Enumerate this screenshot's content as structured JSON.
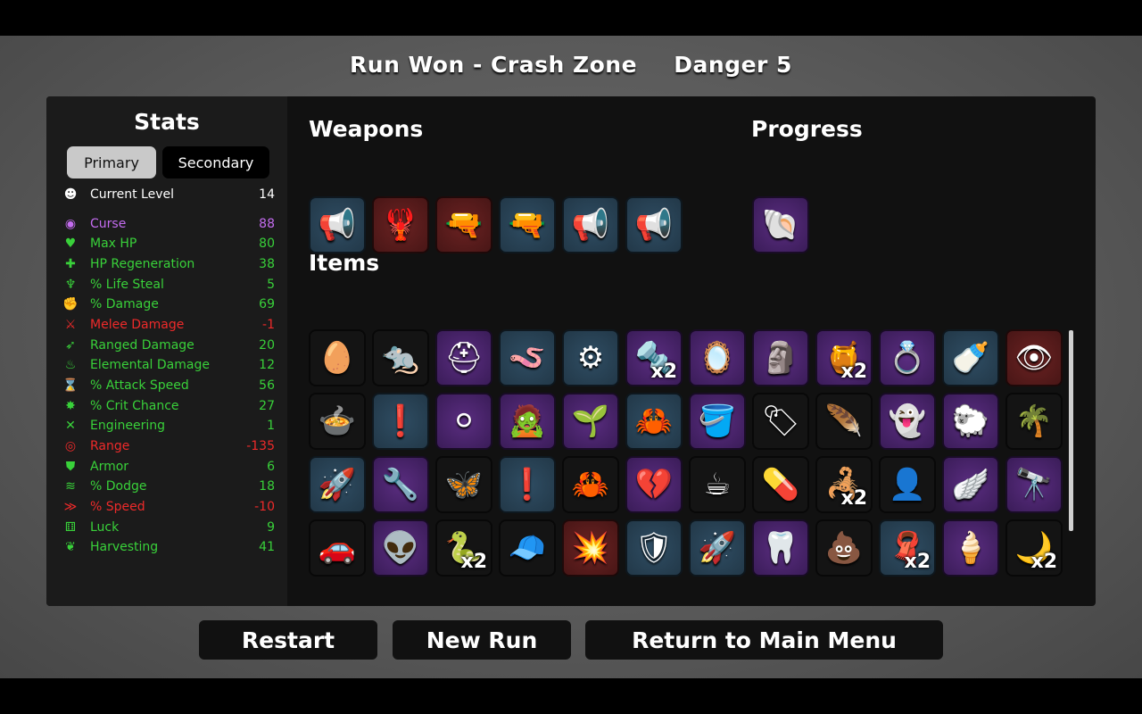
{
  "header": {
    "run_title": "Run Won - Crash Zone",
    "danger": "Danger 5"
  },
  "stats": {
    "title": "Stats",
    "tabs": [
      "Primary",
      "Secondary"
    ],
    "rows": [
      {
        "icon": "☻",
        "label": "Current Level",
        "value": "14",
        "color": "#ffffff"
      },
      {
        "icon": "◉",
        "label": "Curse",
        "value": "88",
        "color": "#c46cf0"
      },
      {
        "icon": "♥",
        "label": "Max HP",
        "value": "80",
        "color": "#39d13a"
      },
      {
        "icon": "✚",
        "label": "HP Regeneration",
        "value": "38",
        "color": "#39d13a"
      },
      {
        "icon": "♆",
        "label": "% Life Steal",
        "value": "5",
        "color": "#39d13a"
      },
      {
        "icon": "✊",
        "label": "% Damage",
        "value": "69",
        "color": "#39d13a"
      },
      {
        "icon": "⚔",
        "label": "Melee Damage",
        "value": "-1",
        "color": "#ee2a2a"
      },
      {
        "icon": "➶",
        "label": "Ranged Damage",
        "value": "20",
        "color": "#39d13a"
      },
      {
        "icon": "♨",
        "label": "Elemental Damage",
        "value": "12",
        "color": "#39d13a"
      },
      {
        "icon": "⌛",
        "label": "% Attack Speed",
        "value": "56",
        "color": "#39d13a"
      },
      {
        "icon": "✸",
        "label": "% Crit Chance",
        "value": "27",
        "color": "#39d13a"
      },
      {
        "icon": "✕",
        "label": "Engineering",
        "value": "1",
        "color": "#39d13a"
      },
      {
        "icon": "◎",
        "label": "Range",
        "value": "-135",
        "color": "#ee2a2a"
      },
      {
        "icon": "⛊",
        "label": "Armor",
        "value": "6",
        "color": "#39d13a"
      },
      {
        "icon": "≋",
        "label": "% Dodge",
        "value": "18",
        "color": "#39d13a"
      },
      {
        "icon": "≫",
        "label": "% Speed",
        "value": "-10",
        "color": "#ee2a2a"
      },
      {
        "icon": "⚅",
        "label": "Luck",
        "value": "9",
        "color": "#39d13a"
      },
      {
        "icon": "❦",
        "label": "Harvesting",
        "value": "41",
        "color": "#39d13a"
      }
    ]
  },
  "weapons": {
    "title": "Weapons",
    "items": [
      {
        "icon": "megaphone-icon",
        "glyph": "📢",
        "bg": "blue"
      },
      {
        "icon": "lobster-icon",
        "glyph": "🦞",
        "bg": "red"
      },
      {
        "icon": "revolver-icon",
        "glyph": "🔫",
        "bg": "red"
      },
      {
        "icon": "revolver-icon",
        "glyph": "🔫",
        "bg": "blue"
      },
      {
        "icon": "megaphone-icon",
        "glyph": "📢",
        "bg": "blue"
      },
      {
        "icon": "megaphone-icon",
        "glyph": "📢",
        "bg": "blue"
      }
    ]
  },
  "progress": {
    "title": "Progress",
    "items": [
      {
        "icon": "hermit-crab-icon",
        "glyph": "🐚",
        "bg": "purple"
      }
    ]
  },
  "items": {
    "title": "Items",
    "list": [
      {
        "icon": "egg-skull-icon",
        "glyph": "🥚",
        "bg": "dark",
        "count": ""
      },
      {
        "icon": "ferret-icon",
        "glyph": "🐀",
        "bg": "dark",
        "count": ""
      },
      {
        "icon": "knight-helmet-icon",
        "glyph": "⛑",
        "bg": "purple",
        "count": ""
      },
      {
        "icon": "worm-icon",
        "glyph": "🪱",
        "bg": "blue",
        "count": ""
      },
      {
        "icon": "gear-ring-icon",
        "glyph": "⚙",
        "bg": "blue",
        "count": ""
      },
      {
        "icon": "bullet-icon",
        "glyph": "🔩",
        "bg": "purple",
        "count": "x2"
      },
      {
        "icon": "mirror-icon",
        "glyph": "🪞",
        "bg": "purple",
        "count": ""
      },
      {
        "icon": "statue-icon",
        "glyph": "🗿",
        "bg": "purple",
        "count": ""
      },
      {
        "icon": "honey-jar-icon",
        "glyph": "🍯",
        "bg": "purple",
        "count": "x2"
      },
      {
        "icon": "ring-icon",
        "glyph": "💍",
        "bg": "purple",
        "count": ""
      },
      {
        "icon": "bottle-icon",
        "glyph": "🍼",
        "bg": "blue",
        "count": ""
      },
      {
        "icon": "eye-swirl-icon",
        "glyph": "👁",
        "bg": "red",
        "count": ""
      },
      {
        "icon": "pot-icon",
        "glyph": "🍲",
        "bg": "dark",
        "count": ""
      },
      {
        "icon": "alert-slime-icon",
        "glyph": "❗",
        "bg": "blue",
        "count": ""
      },
      {
        "icon": "snowball-icon",
        "glyph": "⚪",
        "bg": "purple",
        "count": ""
      },
      {
        "icon": "zombie-head-icon",
        "glyph": "🧟",
        "bg": "purple",
        "count": ""
      },
      {
        "icon": "sprout-icon",
        "glyph": "🌱",
        "bg": "purple",
        "count": ""
      },
      {
        "icon": "claw-ring-icon",
        "glyph": "🦀",
        "bg": "blue",
        "count": ""
      },
      {
        "icon": "barrel-icon",
        "glyph": "🪣",
        "bg": "purple",
        "count": ""
      },
      {
        "icon": "tag-icon",
        "glyph": "🏷",
        "bg": "dark",
        "count": ""
      },
      {
        "icon": "feather-icon",
        "glyph": "🪶",
        "bg": "dark",
        "count": ""
      },
      {
        "icon": "ghost-blob-icon",
        "glyph": "👻",
        "bg": "purple",
        "count": ""
      },
      {
        "icon": "tardigrade-icon",
        "glyph": "🐑",
        "bg": "purple",
        "count": ""
      },
      {
        "icon": "palm-tree-icon",
        "glyph": "🌴",
        "bg": "dark",
        "count": ""
      },
      {
        "icon": "rocket-icon",
        "glyph": "🚀",
        "bg": "blue",
        "count": ""
      },
      {
        "icon": "screw-arm-icon",
        "glyph": "🔧",
        "bg": "purple",
        "count": ""
      },
      {
        "icon": "butterfly-icon",
        "glyph": "🦋",
        "bg": "dark",
        "count": ""
      },
      {
        "icon": "alert-slime-icon",
        "glyph": "❗",
        "bg": "blue",
        "count": ""
      },
      {
        "icon": "claw-ring-icon",
        "glyph": "🦀",
        "bg": "dark",
        "count": ""
      },
      {
        "icon": "frozen-heart-icon",
        "glyph": "💔",
        "bg": "purple",
        "count": ""
      },
      {
        "icon": "coffee-cup-icon",
        "glyph": "☕",
        "bg": "dark",
        "count": ""
      },
      {
        "icon": "capsule-icon",
        "glyph": "💊",
        "bg": "dark",
        "count": ""
      },
      {
        "icon": "red-claws-icon",
        "glyph": "🦂",
        "bg": "dark",
        "count": "x2"
      },
      {
        "icon": "ghost-icon",
        "glyph": "👤",
        "bg": "dark",
        "count": ""
      },
      {
        "icon": "wings-icon",
        "glyph": "🪽",
        "bg": "purple",
        "count": ""
      },
      {
        "icon": "spyglass-icon",
        "glyph": "🔭",
        "bg": "purple",
        "count": ""
      },
      {
        "icon": "crashed-car-icon",
        "glyph": "🚗",
        "bg": "dark",
        "count": ""
      },
      {
        "icon": "alien-doll-icon",
        "glyph": "👽",
        "bg": "purple",
        "count": ""
      },
      {
        "icon": "snake-icon",
        "glyph": "🐍",
        "bg": "dark",
        "count": "x2"
      },
      {
        "icon": "propeller-cap-icon",
        "glyph": "🧢",
        "bg": "dark",
        "count": ""
      },
      {
        "icon": "exploding-bullet-icon",
        "glyph": "💥",
        "bg": "red",
        "count": ""
      },
      {
        "icon": "metal-guard-icon",
        "glyph": "🛡",
        "bg": "blue",
        "count": ""
      },
      {
        "icon": "missile-icon",
        "glyph": "🚀",
        "bg": "blue",
        "count": ""
      },
      {
        "icon": "tooth-icon",
        "glyph": "🦷",
        "bg": "purple",
        "count": ""
      },
      {
        "icon": "dirt-sack-icon",
        "glyph": "💩",
        "bg": "dark",
        "count": ""
      },
      {
        "icon": "scarf-icon",
        "glyph": "🧣",
        "bg": "blue",
        "count": "x2"
      },
      {
        "icon": "slime-stack-icon",
        "glyph": "🍦",
        "bg": "purple",
        "count": ""
      },
      {
        "icon": "crescent-blade-icon",
        "glyph": "🌙",
        "bg": "dark",
        "count": "x2"
      }
    ]
  },
  "buttons": {
    "restart": "Restart",
    "new_run": "New Run",
    "main_menu": "Return to Main Menu"
  }
}
